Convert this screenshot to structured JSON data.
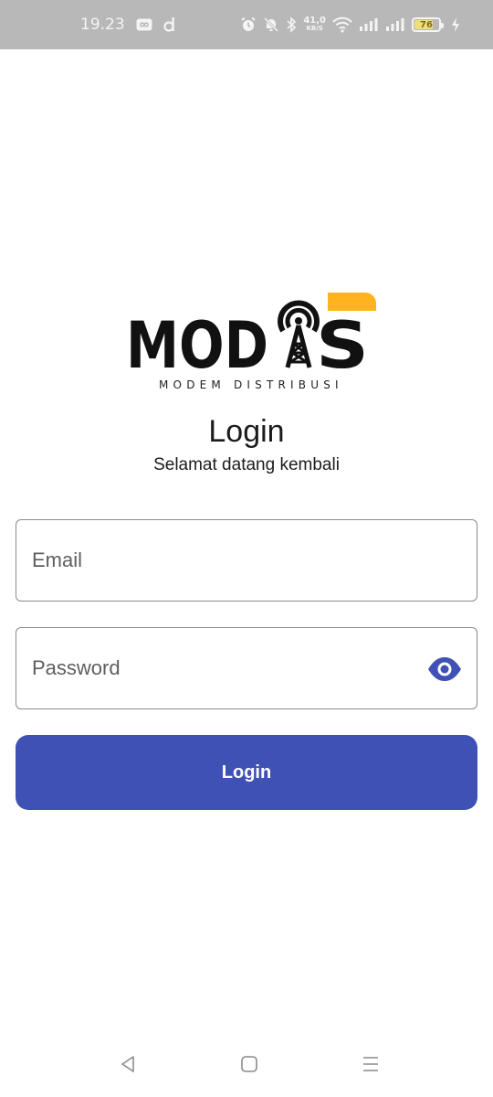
{
  "status_bar": {
    "time": "19.23",
    "net_speed_value": "41,0",
    "net_speed_unit": "KB/S",
    "battery_level": "76",
    "battery_fraction": 0.76,
    "icons": [
      "infinity-icon",
      "d-app-icon",
      "alarm-icon",
      "bell-off-icon",
      "bluetooth-icon",
      "wifi-icon",
      "signal-icon",
      "signal-icon",
      "battery-icon",
      "charging-icon"
    ]
  },
  "logo": {
    "text": "MODIS",
    "tagline": "MODEM DISTRIBUSI",
    "accent_color": "#ffb41f",
    "text_color": "#111111"
  },
  "header": {
    "title": "Login",
    "subtitle": "Selamat datang kembali"
  },
  "form": {
    "email": {
      "placeholder": "Email",
      "value": ""
    },
    "password": {
      "placeholder": "Password",
      "value": "",
      "toggle_icon": "eye-icon"
    },
    "submit_label": "Login",
    "primary_color": "#3f51b5"
  },
  "nav_bar": {
    "icons": [
      "back-icon",
      "home-icon",
      "menu-icon"
    ]
  }
}
